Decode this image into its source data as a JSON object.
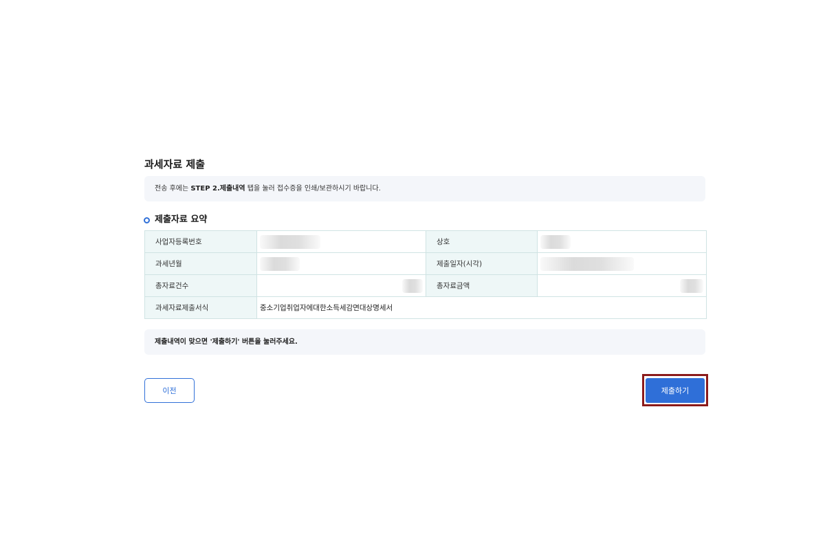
{
  "page": {
    "title": "과세자료 제출",
    "notice_prefix": "전송 후에는 ",
    "notice_bold": "STEP 2.제출내역",
    "notice_suffix": " 탭을 눌러 접수증을 인쇄/보관하시기 바랍니다."
  },
  "summary": {
    "section_title": "제출자료 요약",
    "rows": [
      {
        "label1": "사업자등록번호",
        "value1": "",
        "label2": "상호",
        "value2": ""
      },
      {
        "label1": "과세년월",
        "value1": "",
        "label2": "제출일자(시각)",
        "value2": ""
      },
      {
        "label1": "총자료건수",
        "value1": "",
        "label2": "총자료금액",
        "value2": ""
      },
      {
        "label1": "과세자료제출서식",
        "value1": "중소기업취업자에대한소득세감면대상명세서"
      }
    ]
  },
  "confirm_notice": "제출내역이 맞으면 '제출하기' 버튼을 눌러주세요.",
  "buttons": {
    "prev_label": "이전",
    "submit_label": "제출하기"
  },
  "colors": {
    "accent": "#2f6fd8",
    "table_header_bg": "#eef7f7",
    "notice_bg": "#f4f6fa",
    "highlight_frame": "#8b1a1a"
  }
}
